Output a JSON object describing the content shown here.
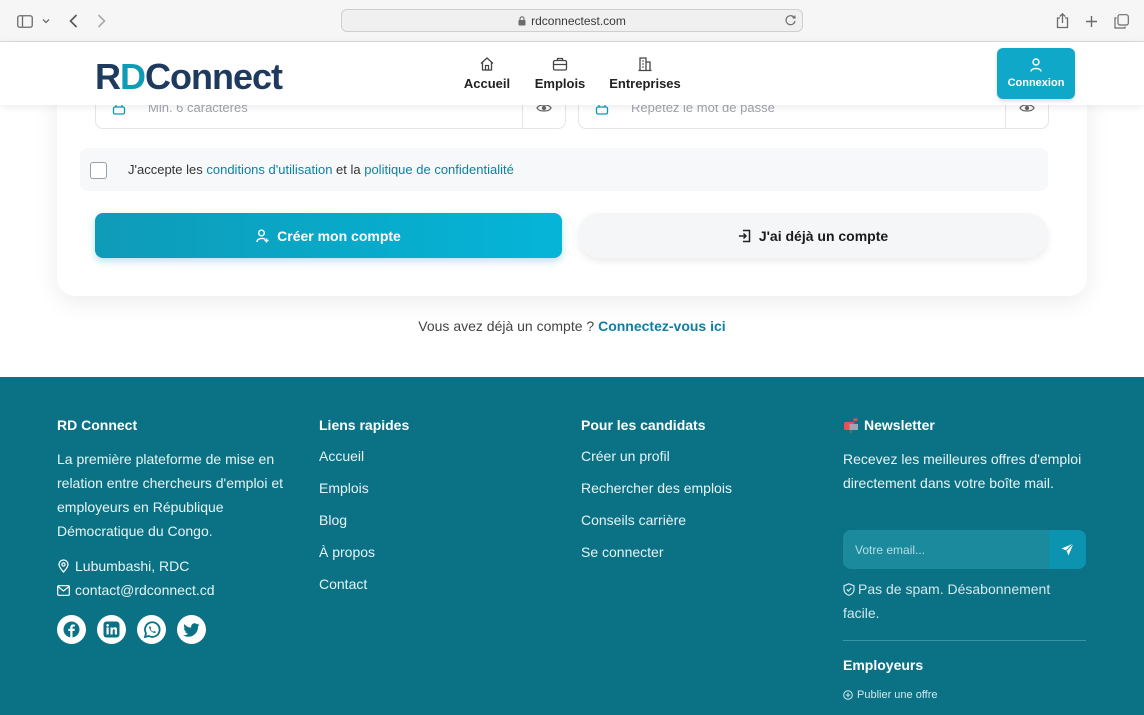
{
  "browser": {
    "url": "rdconnectest.com"
  },
  "header": {
    "logo": {
      "r": "R",
      "d": "D",
      "rest": "Connect"
    },
    "nav": [
      {
        "label": "Accueil",
        "icon": "home-icon"
      },
      {
        "label": "Emplois",
        "icon": "briefcase-icon"
      },
      {
        "label": "Entreprises",
        "icon": "building-icon"
      }
    ],
    "login_label": "Connexion"
  },
  "form": {
    "password_placeholder": "Min. 6 caractères",
    "confirm_placeholder": "Répétez le mot de passe",
    "terms": {
      "prefix": "J'accepte les ",
      "link1": "conditions d'utilisation",
      "middle": " et la ",
      "link2": "politique de confidentialité"
    },
    "create_label": "Créer mon compte",
    "existing_label": "J'ai déjà un compte",
    "already_text": "Vous avez déjà un compte ? ",
    "already_link": "Connectez-vous ici"
  },
  "footer": {
    "about": {
      "title": "RD Connect",
      "description": "La première plateforme de mise en relation entre chercheurs d'emploi et employeurs en République Démocratique du Congo.",
      "location": "Lubumbashi, RDC",
      "email": "contact@rdconnect.cd"
    },
    "quick_links": {
      "title": "Liens rapides",
      "items": [
        "Accueil",
        "Emplois",
        "Blog",
        "À propos",
        "Contact"
      ]
    },
    "candidates": {
      "title": "Pour les candidats",
      "items": [
        "Créer un profil",
        "Rechercher des emplois",
        "Conseils carrière",
        "Se connecter"
      ]
    },
    "newsletter": {
      "title": "Newsletter",
      "description": "Recevez les meilleures offres d'emploi directement dans votre boîte mail.",
      "placeholder": "Votre email...",
      "note": "Pas de spam. Désabonnement facile."
    },
    "employers": {
      "title": "Employeurs",
      "publish": "Publier une offre"
    },
    "socials": [
      "facebook-icon",
      "linkedin-icon",
      "whatsapp-icon",
      "twitter-icon"
    ]
  },
  "colors": {
    "accent": "#0fa8c8",
    "footer_bg": "#0b7285",
    "logo_dark": "#1e3a5f",
    "link": "#0e7fa3"
  }
}
